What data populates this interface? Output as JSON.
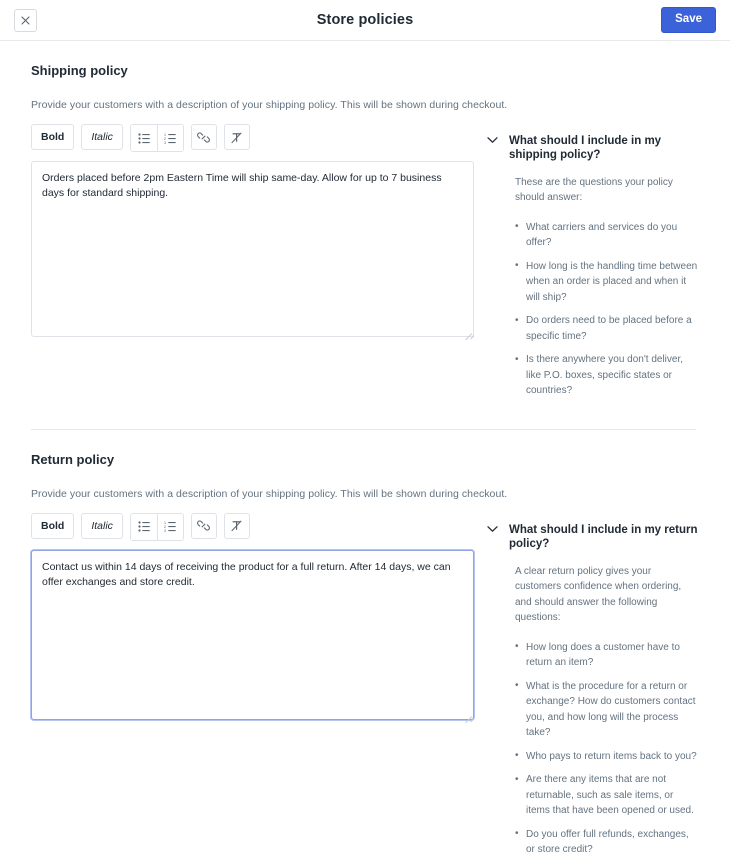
{
  "topbar": {
    "close_icon": "close-icon",
    "title": "Store policies",
    "save_label": "Save"
  },
  "toolbar": {
    "bold_label": "Bold",
    "italic_label": "Italic",
    "bulleted_list_icon": "bulleted-list-icon",
    "numbered_list_icon": "numbered-list-icon",
    "link_icon": "link-icon",
    "clear_formatting_icon": "clear-formatting-icon"
  },
  "shipping": {
    "title": "Shipping policy",
    "description": "Provide your customers with a description of your shipping policy. This will be shown during checkout.",
    "editor_value": "Orders placed before 2pm Eastern Time will ship same-day. Allow for up to 7 business days for standard shipping.",
    "editor_placeholder": "",
    "help": {
      "chevron_icon": "chevron-down-icon",
      "title": "What should I include in my shipping policy?",
      "intro": "These are the questions your policy should answer:",
      "items": [
        "What carriers and services do you offer?",
        "How long is the handling time between when an order is placed and when it will ship?",
        "Do orders need to be placed before a specific time?",
        "Is there anywhere you don't deliver, like P.O. boxes, specific states or countries?"
      ]
    }
  },
  "returns": {
    "title": "Return policy",
    "description": "Provide your customers with a description of your shipping policy. This will be shown during checkout.",
    "editor_value": "Contact us within 14 days of receiving the product for a full return. After 14 days, we can offer exchanges and store credit.",
    "editor_placeholder": "",
    "help": {
      "chevron_icon": "chevron-down-icon",
      "title": "What should I include in my return policy?",
      "intro": "A clear return policy gives your customers confidence when ordering, and should answer the following questions:",
      "items": [
        "How long does a customer have to return an item?",
        "What is the procedure for a return or exchange? How do customers contact you, and how long will the process take?",
        "Who pays to return items back to you?",
        "Are there any items that are not returnable, such as sale items, or items that have been opened or used.",
        "Do you offer full refunds, exchanges, or store credit?"
      ]
    }
  },
  "colors": {
    "accent": "#3b62d8",
    "text": "#212b36",
    "muted": "#637381",
    "border": "#dfe3e8",
    "focus_border": "#8fa3e6"
  }
}
